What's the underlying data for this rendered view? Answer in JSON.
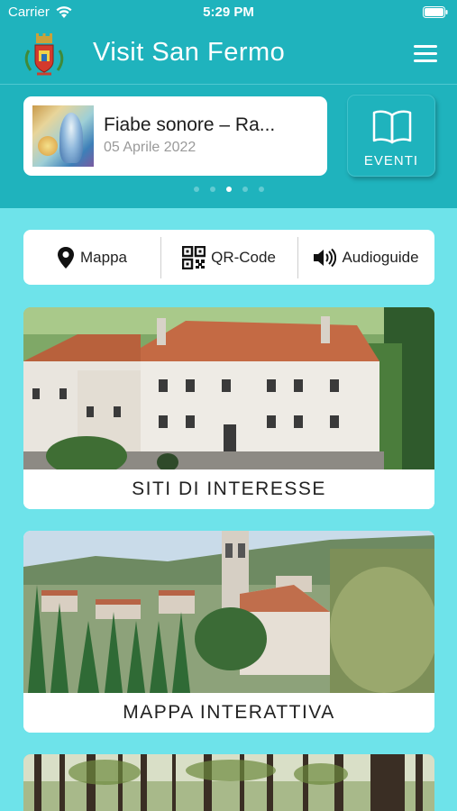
{
  "status": {
    "carrier": "Carrier",
    "time": "5:29 PM"
  },
  "header": {
    "title": "Visit San Fermo"
  },
  "carousel": {
    "event_title": "Fiabe sonore – Ra...",
    "event_date": "05 Aprile 2022",
    "eventi_label": "EVENTI",
    "active_page": 3,
    "page_count": 5
  },
  "quick": {
    "map": "Mappa",
    "qr": "QR-Code",
    "audio": "Audioguide"
  },
  "tiles": [
    {
      "caption": "SITI DI INTERESSE"
    },
    {
      "caption": "MAPPA INTERATTIVA"
    },
    {
      "caption": ""
    }
  ],
  "colors": {
    "primary": "#1fb3bd",
    "background": "#6ee3ea",
    "card": "#ffffff"
  }
}
